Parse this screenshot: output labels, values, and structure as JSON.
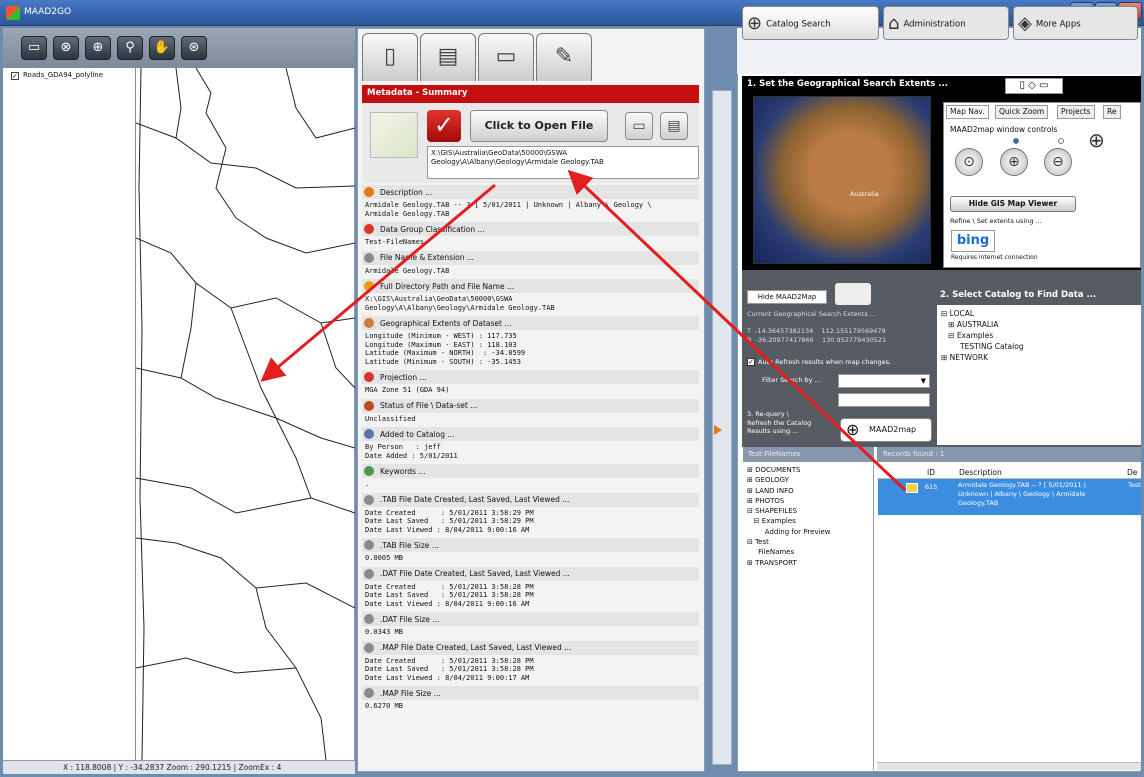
{
  "window": {
    "title": "MAAD2GO",
    "min": "–",
    "max": "□",
    "close": "X"
  },
  "map": {
    "layer_name": "Roads_GDA94_polyline",
    "status": "X : 118.8008 | Y : -34.2837      Zoom : 290.1215 | ZoomEx : 4"
  },
  "metadata": {
    "header": "Metadata - Summary",
    "open_file_label": "Click to Open File",
    "path": "X:\\GIS\\Australia\\GeoData\\50000\\GSWA Geology\\A\\Albany\\Geology\\Armidale Geology.TAB",
    "sections": [
      {
        "title": "Description ...",
        "value": "Armidale Geology.TAB -- ? [ 5/01/2011 | Unknown | Albany \\ Geology \\\nArmidale Geology.TAB"
      },
      {
        "title": "Data Group Classification ...",
        "value": "Test-FileNames"
      },
      {
        "title": "File Name & Extension ...",
        "value": "Armidale Geology.TAB"
      },
      {
        "title": "Full Directory Path and File Name ...",
        "value": "X:\\GIS\\Australia\\GeoData\\50000\\GSWA\nGeology\\A\\Albany\\Geology\\Armidale Geology.TAB"
      },
      {
        "title": "Geographical Extents of Dataset ...",
        "value": "Longitude (Minimum - WEST) : 117.735\nLongitude (Maximum - EAST) : 118.103\nLatitude (Maximum - NORTH)  : -34.8599\nLatitude (Minimum - SOUTH) : -35.1453"
      },
      {
        "title": "Projection ...",
        "value": "MGA Zone 51 (GDA 94)"
      },
      {
        "title": "Status of File \\ Data-set ...",
        "value": "Unclassified"
      },
      {
        "title": "Added to Catalog ...",
        "value": "By Person   : jeff\nDate Added : 5/01/2011"
      },
      {
        "title": "Keywords ...",
        "value": "."
      },
      {
        "title": ".TAB File Date Created, Last Saved, Last Viewed ...",
        "value": "Date Created      : 5/01/2011 3:58:29 PM\nDate Last Saved   : 5/01/2011 3:58:29 PM\nDate Last Viewed : 8/04/2011 9:00:16 AM"
      },
      {
        "title": ".TAB File Size ...",
        "value": "0.0005 MB"
      },
      {
        "title": ".DAT File Date Created, Last Saved, Last Viewed ...",
        "value": "Date Created      : 5/01/2011 3:58:28 PM\nDate Last Saved   : 5/01/2011 3:58:28 PM\nDate Last Viewed : 8/04/2011 9:00:16 AM"
      },
      {
        "title": ".DAT File Size ...",
        "value": "0.0343 MB"
      },
      {
        "title": ".MAP File Date Created, Last Saved, Last Viewed ...",
        "value": "Date Created      : 5/01/2011 3:58:28 PM\nDate Last Saved   : 5/01/2011 3:58:28 PM\nDate Last Viewed : 8/04/2011 9:00:17 AM"
      },
      {
        "title": ".MAP File Size ...",
        "value": "0.6270 MB"
      }
    ]
  },
  "right": {
    "tabs": [
      "Catalog Search",
      "Administration",
      "More Apps"
    ],
    "geo_title": "1. Set the Geographical Search Extents ...",
    "sat_label": "Australia",
    "mapnav_tabs": [
      "Map Nav.",
      "Quick Zoom",
      "Projects",
      "Re"
    ],
    "mapnav_label": "MAAD2map window controls",
    "hide_gis": "Hide GIS Map Viewer",
    "refine": "Refine \\ Set extents using ...",
    "bing": "bing",
    "req_net": "Requires internet connection",
    "hide_maad": "Hide MAAD2Map",
    "select_title": "2. Select Catalog to Find Data ...",
    "extents": "Current Geographical Search Extents ...\n\nT  -14.36457382134    112.155179569479\nB  -36.20977417866    130.952779430521",
    "auto_refresh": "Auto Refresh results when map changes.",
    "filter_label": "Filter Search by ...",
    "requery": "3. Re-query \\\nRefresh the Catalog\nResults using ...",
    "maad2map": "MAAD2map",
    "catalog_tree": "⊟ LOCAL\n   ⊞ AUSTRALIA\n   ⊟ Examples\n        TESTING Catalog\n⊞ NETWORK",
    "group_header": "Test-FileNames",
    "records_header": "Records found : 1",
    "group_tree": "⊞ DOCUMENTS\n⊞ GEOLOGY\n⊞ LAND INFO\n⊞ PHOTOS\n⊟ SHAPEFILES\n   ⊟ Examples\n        Adding for Preview\n⊟ Test\n     FileNames\n⊞ TRANSPORT",
    "col_id": "ID",
    "col_desc": "Description",
    "col_extra": "De",
    "row_id": "615",
    "row_desc": "Armidale Geology.TAB -- ? [ 5/01/2011 |\nUnknown | Albany \\ Geology \\ Armidale\nGeology.TAB",
    "row_extra": "Test"
  }
}
